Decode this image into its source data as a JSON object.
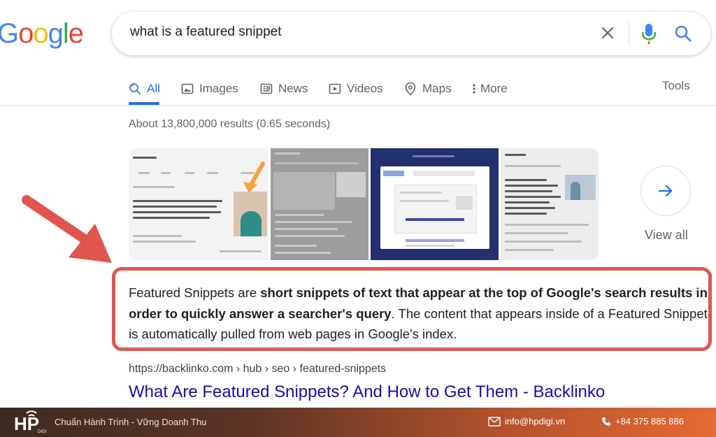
{
  "logo": {
    "letters": [
      "G",
      "o",
      "o",
      "g",
      "l",
      "e"
    ],
    "colors": [
      "#4285f4",
      "#ea4335",
      "#fbbc05",
      "#4285f4",
      "#34a853",
      "#ea4335"
    ]
  },
  "search": {
    "query": "what is a featured snippet"
  },
  "tabs": [
    {
      "label": "All",
      "icon": "search-icon",
      "active": true
    },
    {
      "label": "Images",
      "icon": "image-icon"
    },
    {
      "label": "News",
      "icon": "news-icon"
    },
    {
      "label": "Videos",
      "icon": "video-icon"
    },
    {
      "label": "Maps",
      "icon": "map-pin-icon"
    },
    {
      "label": "More",
      "icon": "more-vert-icon"
    }
  ],
  "tools_label": "Tools",
  "stats": "About 13,800,000 results (0.65 seconds)",
  "images": {
    "view_all": "View all"
  },
  "snippet": {
    "part1": "Featured Snippets are ",
    "bold": "short snippets of text that appear at the top of Google's search results in order to quickly answer a searcher's query",
    "part2": ". The content that appears inside of a Featured Snippet is automatically pulled from web pages in Google's index."
  },
  "result": {
    "url": "https://backlinko.com › hub › seo › featured-snippets",
    "title": "What Are Featured Snippets? And How to Get Them - Backlinko"
  },
  "footer": {
    "brand": "HP",
    "brand_sub": "DIGI",
    "tagline": "Chuẩn Hành Trình - Vững Doanh Thu",
    "email": "info@hpdigi.vn",
    "phone": "+84 375 885 886"
  },
  "colors": {
    "accent_blue": "#1a73e8",
    "link": "#1a0dab",
    "highlight_red": "#e0564f"
  }
}
